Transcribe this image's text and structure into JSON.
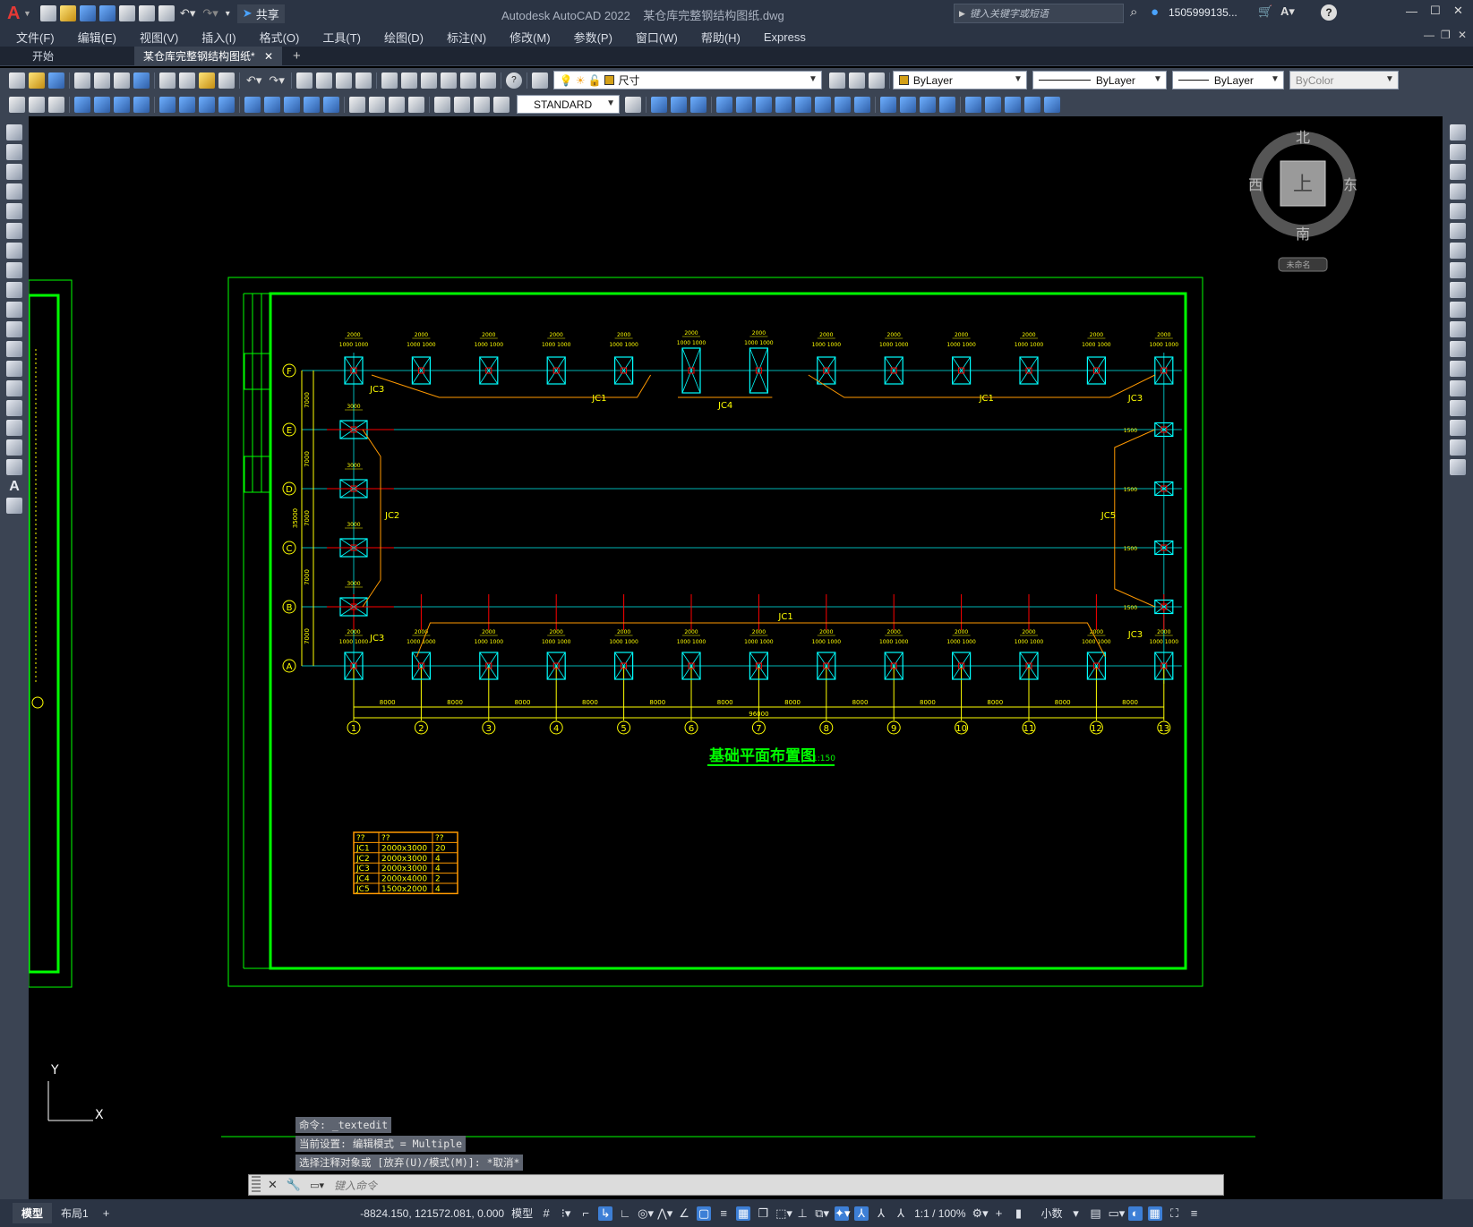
{
  "app": {
    "title": "Autodesk AutoCAD 2022",
    "filename": "某仓库完整钢结构图纸.dwg",
    "search_placeholder": "键入关键字或短语",
    "user": "1505999135...",
    "share_label": "共享",
    "window_controls": [
      "minimize-icon",
      "maximize-icon",
      "close-icon"
    ]
  },
  "menu": [
    "文件(F)",
    "编辑(E)",
    "视图(V)",
    "插入(I)",
    "格式(O)",
    "工具(T)",
    "绘图(D)",
    "标注(N)",
    "修改(M)",
    "参数(P)",
    "窗口(W)",
    "帮助(H)",
    "Express"
  ],
  "tabs": {
    "start": "开始",
    "active": "某仓库完整钢结构图纸*"
  },
  "toolbar": {
    "layer": "尺寸",
    "color": "ByLayer",
    "linetype": "ByLayer",
    "lineweight": "ByLayer",
    "plotstyle": "ByColor",
    "textstyle": "STANDARD",
    "layer_color": "#d4a017"
  },
  "viewcube": {
    "north": "北",
    "south": "南",
    "west": "西",
    "east": "东",
    "top": "上",
    "wcs": "未命名"
  },
  "drawing": {
    "title": "基础平面布置图",
    "scale": "1:150",
    "grid_rows": [
      "F",
      "E",
      "D",
      "C",
      "B",
      "A"
    ],
    "grid_cols": [
      "1",
      "2",
      "3",
      "4",
      "5",
      "6",
      "7",
      "8",
      "9",
      "10",
      "11",
      "12",
      "13"
    ],
    "row_spacing": [
      "7000",
      "7000",
      "7000",
      "7000",
      "7000"
    ],
    "total_height": "35000",
    "col_spacing": [
      "8000",
      "8000",
      "8000",
      "8000",
      "8000",
      "8000",
      "8000",
      "8000",
      "8000",
      "8000",
      "8000",
      "8000"
    ],
    "total_width": "96000",
    "foundation_labels": {
      "jc1": "JC1",
      "jc2": "JC2",
      "jc3": "JC3",
      "jc4": "JC4",
      "jc5": "JC5"
    },
    "dim_2000": "2000",
    "dim_3000": "3000",
    "dim_1000": "1000 1000",
    "dim_1500": "1500"
  },
  "schedule": {
    "headers": [
      "??",
      "??",
      "??"
    ],
    "rows": [
      [
        "JC1",
        "2000x3000",
        "20"
      ],
      [
        "JC2",
        "2000x3000",
        "4"
      ],
      [
        "JC3",
        "2000x3000",
        "4"
      ],
      [
        "JC4",
        "2000x4000",
        "2"
      ],
      [
        "JC5",
        "1500x2000",
        "4"
      ]
    ]
  },
  "ucs": {
    "y": "Y",
    "x": "X"
  },
  "command": {
    "history": [
      "命令: _textedit",
      "当前设置: 编辑模式 = Multiple",
      "选择注释对象或 [放弃(U)/模式(M)]: *取消*"
    ],
    "placeholder": "键入命令"
  },
  "layout_tabs": [
    "模型",
    "布局1"
  ],
  "status": {
    "coords": "-8824.150, 121572.081, 0.000",
    "mode": "模型",
    "scale": "1:1 / 100%",
    "units": "小数"
  },
  "colors": {
    "green": "#00ff00",
    "yellow": "#ffff00",
    "cyan": "#00ffff",
    "orange": "#ff9900",
    "red": "#ff0000"
  }
}
